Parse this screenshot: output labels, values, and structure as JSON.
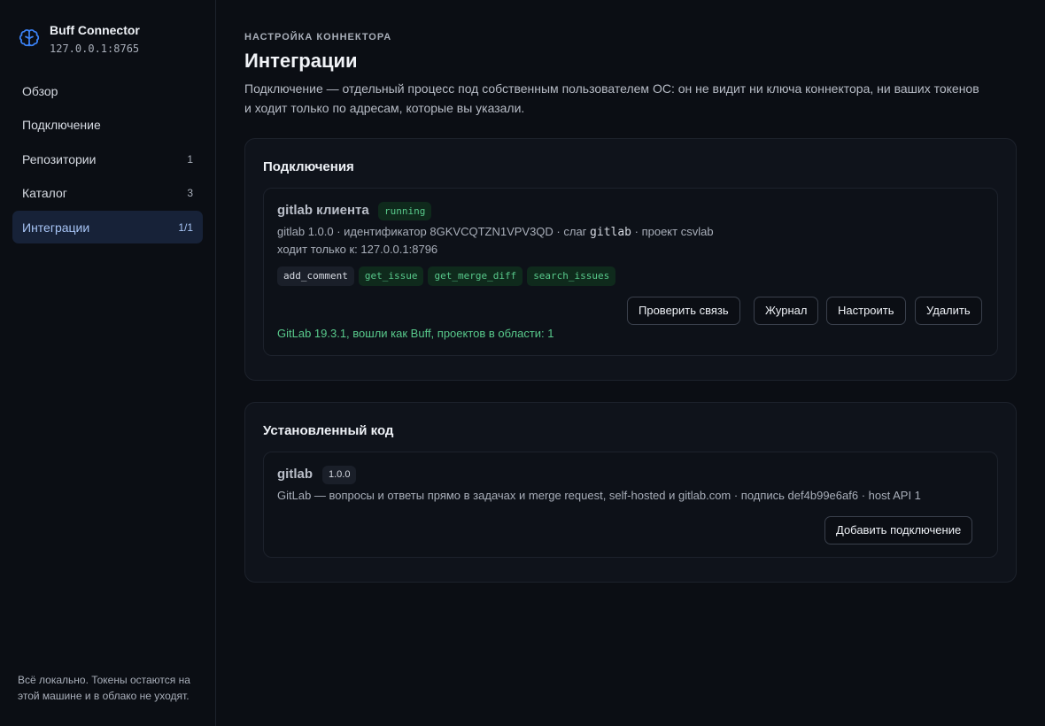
{
  "brand": {
    "title": "Buff Connector",
    "address": "127.0.0.1:8765",
    "icon": "brain-icon",
    "accent": "#3b82f6"
  },
  "nav": [
    {
      "label": "Обзор",
      "count": ""
    },
    {
      "label": "Подключение",
      "count": ""
    },
    {
      "label": "Репозитории",
      "count": "1"
    },
    {
      "label": "Каталог",
      "count": "3"
    },
    {
      "label": "Интеграции",
      "count": "1/1",
      "active": true
    }
  ],
  "sidebar_footer": "Всё локально. Токены остаются на этой машине и в облако не уходят.",
  "page": {
    "eyebrow": "НАСТРОЙКА КОННЕКТОРА",
    "title": "Интеграции",
    "description": "Подключение — отдельный процесс под собственным пользователем ОС: он не видит ни ключа коннектора, ни ваших токенов и ходит только по адресам, которые вы указали."
  },
  "connections": {
    "title": "Подключения",
    "item": {
      "name": "gitlab клиента",
      "status": "running",
      "meta_prefix": "gitlab 1.0.0 · идентификатор 8GKVCQTZN1VPV3QD · слаг",
      "slug": "gitlab",
      "meta_suffix": "· проект csvlab",
      "allowed": "ходит только к: 127.0.0.1:8796",
      "tools": [
        {
          "name": "add_comment",
          "style": "neutral"
        },
        {
          "name": "get_issue",
          "style": "green"
        },
        {
          "name": "get_merge_diff",
          "style": "green"
        },
        {
          "name": "search_issues",
          "style": "green"
        }
      ],
      "buttons": {
        "check": "Проверить связь",
        "log": "Журнал",
        "configure": "Настроить",
        "delete": "Удалить"
      },
      "check_result": "GitLab 19.3.1, вошли как Buff, проектов в области: 1"
    }
  },
  "installed": {
    "title": "Установленный код",
    "item": {
      "name": "gitlab",
      "version": "1.0.0",
      "description": "GitLab — вопросы и ответы прямо в задачах и merge request, self-hosted и gitlab.com · подпись def4b99e6af6 · host API 1",
      "add_button": "Добавить подключение"
    }
  }
}
